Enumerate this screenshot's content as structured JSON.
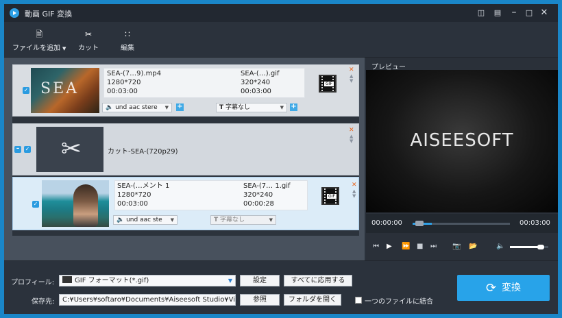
{
  "window": {
    "title": "動画 GIF 変換"
  },
  "titlebar_icons": [
    "feedback-icon",
    "register-icon",
    "minimize-icon",
    "maximize-icon",
    "close-icon"
  ],
  "toolbar": {
    "add_file": "ファイルを追加",
    "cut": "カット",
    "edit": "編集"
  },
  "items": [
    {
      "source_name": "SEA-(7…9).mp4",
      "source_res": "1280*720",
      "source_dur": "00:03:00",
      "out_name": "SEA-(…).gif",
      "out_res": "320*240",
      "out_dur": "00:03:00",
      "audio": "und aac stere",
      "subtitle": "字幕なし",
      "thumb_text": "SEA",
      "gif_tag": "GIF"
    },
    {
      "group_label": "カット-SEA-(720p29)"
    },
    {
      "source_name": "SEA-(…メント 1",
      "source_res": "1280*720",
      "source_dur": "00:03:00",
      "out_name": "SEA-(7… 1.gif",
      "out_res": "320*240",
      "out_dur": "00:00:28",
      "audio": "und aac ste",
      "subtitle": "字幕なし",
      "gif_tag": "GIF"
    }
  ],
  "preview": {
    "title": "プレビュー",
    "logo": "AISEESOFT",
    "time_current": "00:00:00",
    "time_total": "00:03:00",
    "seek_progress": 0.2,
    "volume": 0.8
  },
  "bottom": {
    "profile_label": "プロフィール:",
    "profile_value": "GIF フォーマット(*.gif)",
    "settings_button": "設定",
    "apply_all_button": "すべてに応用する",
    "save_label": "保存先:",
    "save_path": "C:¥Users¥softaro¥Documents¥Aiseesoft Studio¥Vid",
    "browse_button": "参照",
    "open_folder_button": "フォルダを開く",
    "merge_label": "一つのファイルに結合",
    "convert_button": "変換"
  },
  "colors": {
    "accent": "#28a3e9",
    "remove": "#e8661e",
    "panel": "#2b323c"
  }
}
